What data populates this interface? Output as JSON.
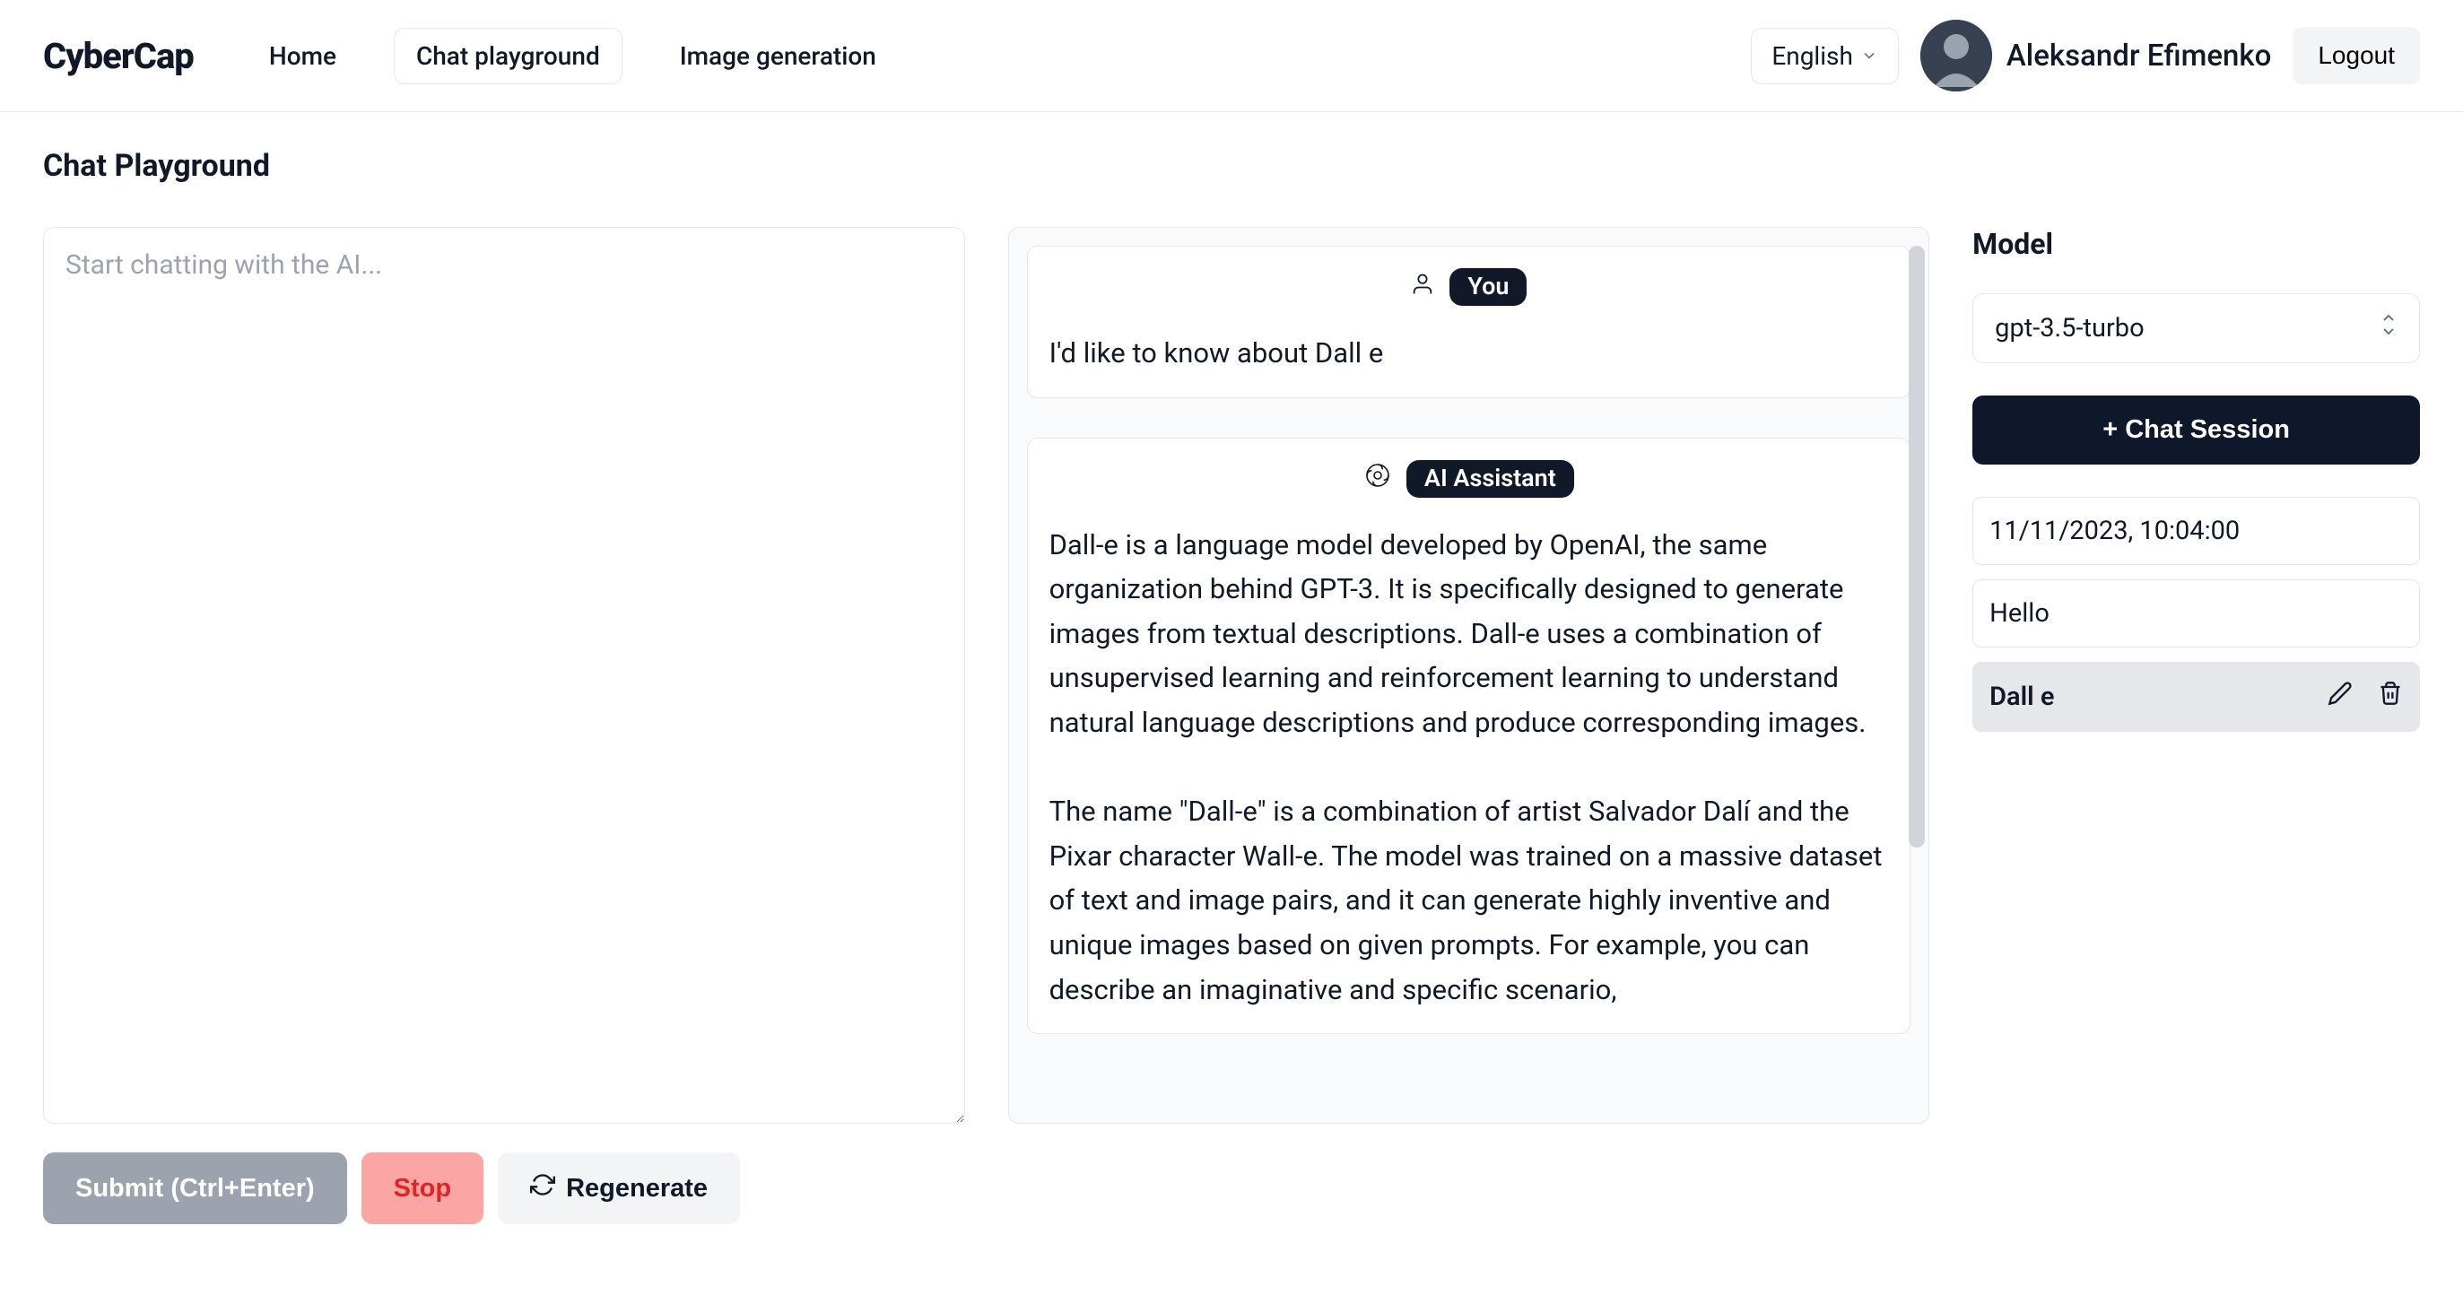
{
  "brand": "CyberCap",
  "nav": {
    "home": "Home",
    "chat_playground": "Chat playground",
    "image_generation": "Image generation"
  },
  "lang": {
    "selected": "English"
  },
  "user": {
    "name": "Aleksandr Efimenko"
  },
  "logout_label": "Logout",
  "page_title": "Chat Playground",
  "input": {
    "placeholder": "Start chatting with the AI..."
  },
  "buttons": {
    "submit": "Submit (Ctrl+Enter)",
    "stop": "Stop",
    "regenerate": "Regenerate"
  },
  "messages": [
    {
      "role": "You",
      "content": "I'd like to know about Dall e"
    },
    {
      "role": "AI Assistant",
      "content": "Dall-e is a language model developed by OpenAI, the same organization behind GPT-3. It is specifically designed to generate images from textual descriptions. Dall-e uses a combination of unsupervised learning and reinforcement learning to understand natural language descriptions and produce corresponding images.\n\nThe name \"Dall-e\" is a combination of artist Salvador Dalí and the Pixar character Wall-e. The model was trained on a massive dataset of text and image pairs, and it can generate highly inventive and unique images based on given prompts. For example, you can describe an imaginative and specific scenario,"
    }
  ],
  "sidebar": {
    "model_label": "Model",
    "model_value": "gpt-3.5-turbo",
    "new_session_label": "+ Chat Session",
    "sessions": [
      {
        "title": "11/11/2023, 10:04:00",
        "active": false
      },
      {
        "title": "Hello",
        "active": false
      },
      {
        "title": "Dall e",
        "active": true
      }
    ]
  }
}
